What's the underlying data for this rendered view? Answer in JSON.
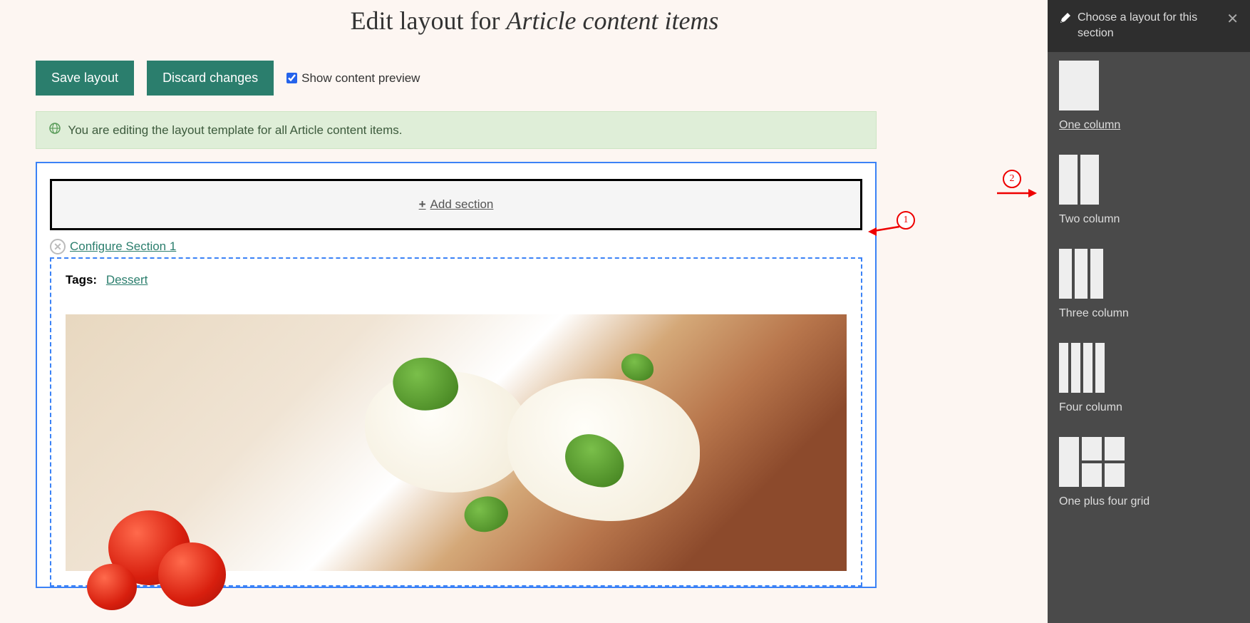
{
  "page": {
    "title_prefix": "Edit layout for ",
    "title_italic": "Article content items"
  },
  "toolbar": {
    "save_label": "Save layout",
    "discard_label": "Discard changes",
    "preview_label": "Show content preview"
  },
  "info": {
    "message": "You are editing the layout template for all Article content items."
  },
  "builder": {
    "add_section_label": "Add section",
    "configure_label": "Configure Section 1",
    "tags_label": "Tags:",
    "tag_value": "Dessert"
  },
  "annotations": {
    "one": "1",
    "two": "2"
  },
  "sidebar": {
    "title": "Choose a layout for this section",
    "options": {
      "one": "One column",
      "two": "Two column",
      "three": "Three column",
      "four": "Four column",
      "grid": "One plus four grid"
    }
  }
}
